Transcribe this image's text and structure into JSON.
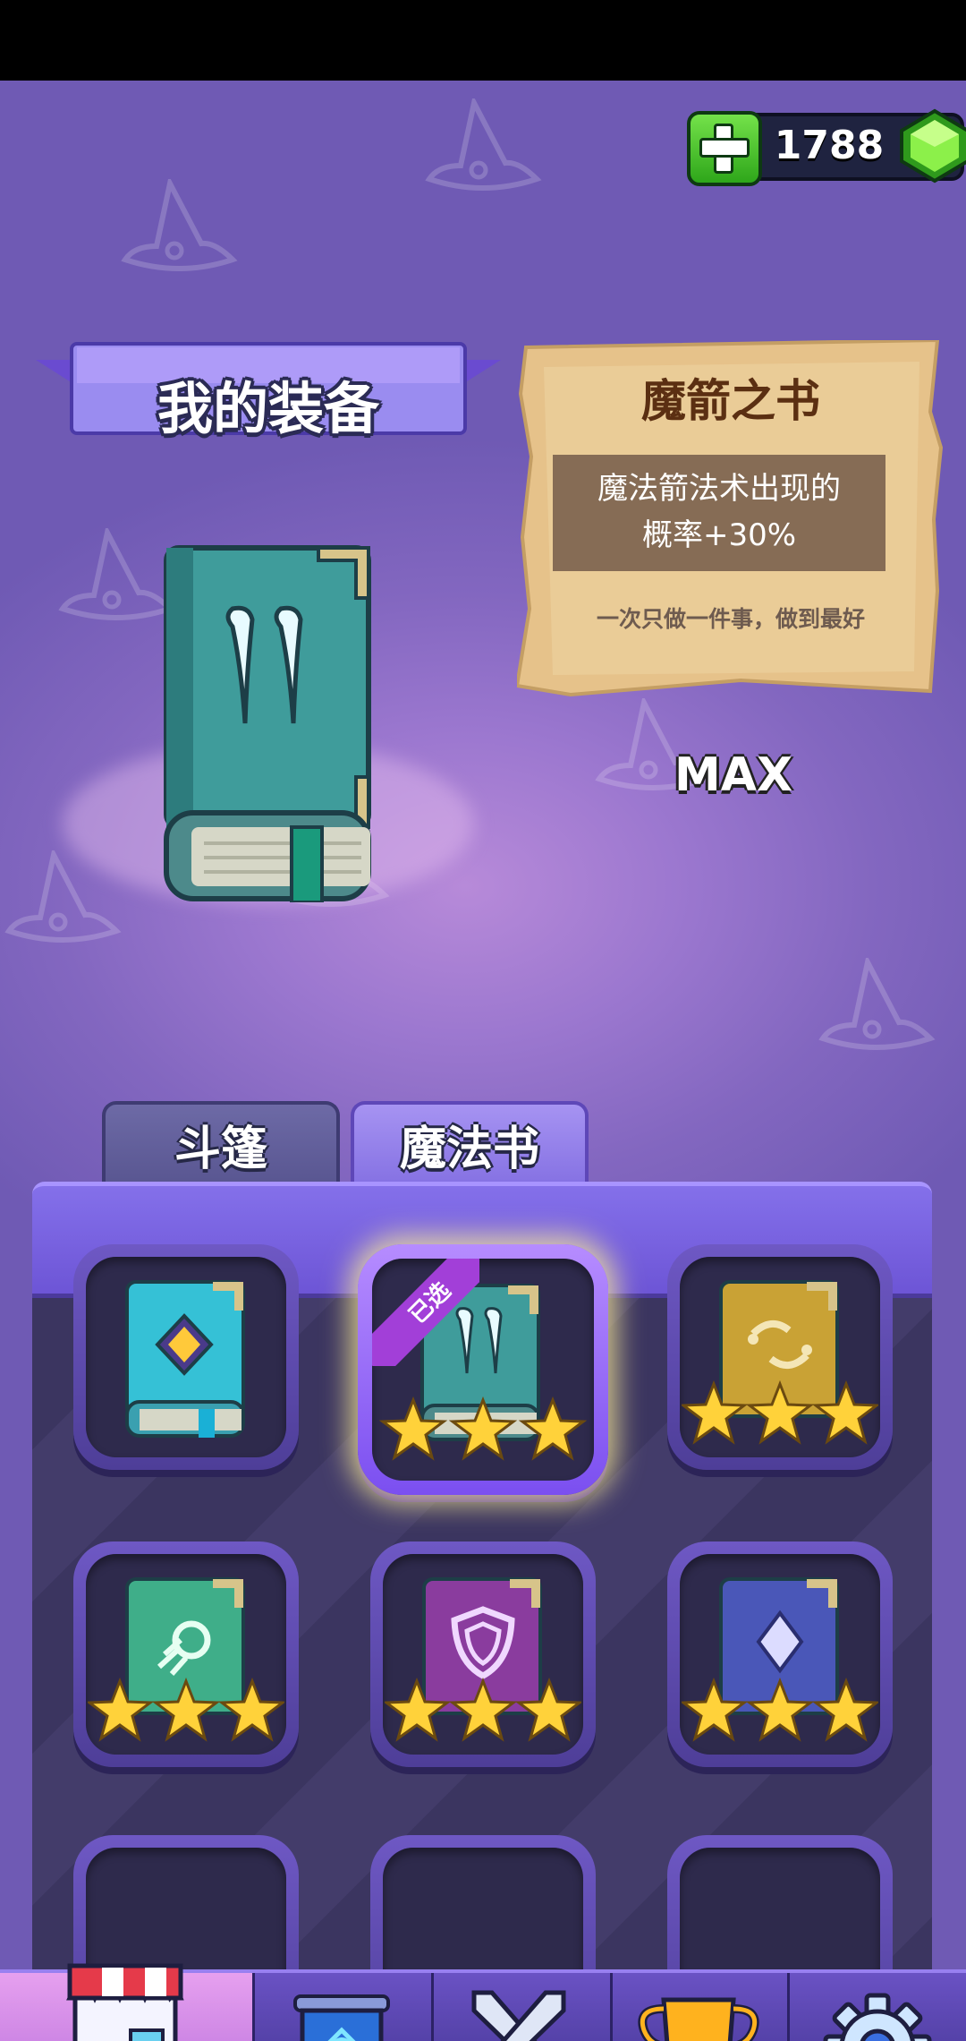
{
  "currency": {
    "amount": "1788",
    "add_icon": "plus-icon",
    "gem_icon": "green-gem-icon"
  },
  "header": {
    "title": "我的装备"
  },
  "equipped": {
    "name": "魔箭之书",
    "description_line1": "魔法箭法术出现的",
    "description_line2": "概率+30%",
    "motto": "一次只做一件事，做到最好",
    "level_label": "MAX"
  },
  "tabs": [
    {
      "label": "斗篷",
      "active": false
    },
    {
      "label": "魔法书",
      "active": true
    }
  ],
  "books": [
    {
      "name": "diamond-book",
      "color": "#35c1d6",
      "stars": 0,
      "selected": false
    },
    {
      "name": "arrow-book",
      "color": "#3f9c9b",
      "stars": 3,
      "selected": true,
      "badge": "已选"
    },
    {
      "name": "swirl-book",
      "color": "#c9a235",
      "stars": 3,
      "selected": false
    },
    {
      "name": "comet-book",
      "color": "#3fae89",
      "stars": 3,
      "selected": false
    },
    {
      "name": "shield-book",
      "color": "#8a3c9e",
      "stars": 3,
      "selected": false
    },
    {
      "name": "crystal-book",
      "color": "#4a57b8",
      "stars": 3,
      "selected": false
    }
  ],
  "nav": [
    {
      "name": "shop",
      "icon": "shop-icon",
      "active": true
    },
    {
      "name": "guild",
      "icon": "banner-icon",
      "active": false
    },
    {
      "name": "battle",
      "icon": "crossed-swords-icon",
      "active": false
    },
    {
      "name": "ranking",
      "icon": "trophy-icon",
      "active": false
    },
    {
      "name": "settings",
      "icon": "gear-icon",
      "active": false
    }
  ],
  "colors": {
    "accent": "#7f6be0",
    "star": "#ffd23a",
    "parchment": "#e6c28a"
  }
}
